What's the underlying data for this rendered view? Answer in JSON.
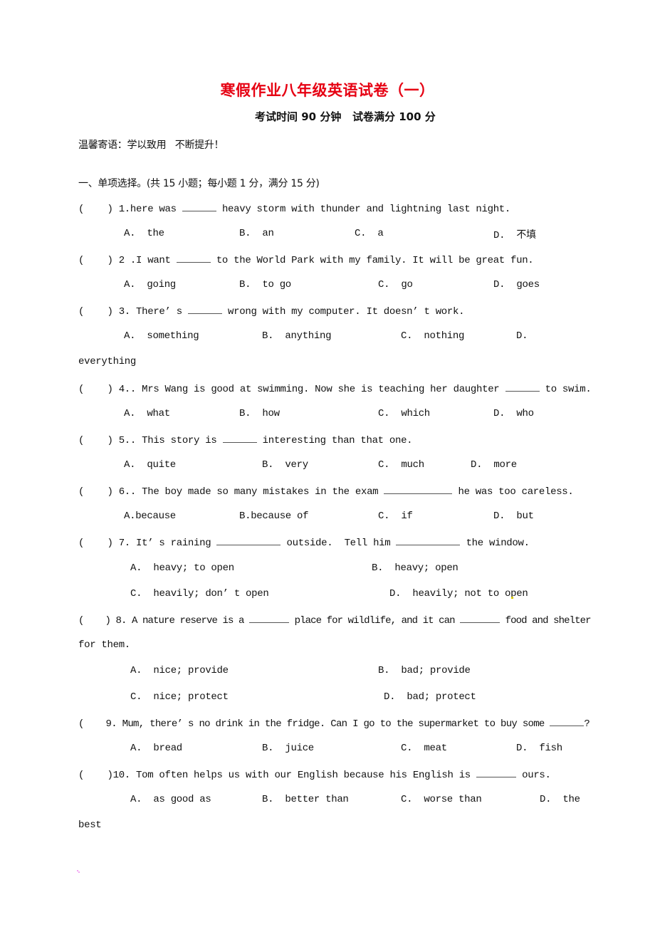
{
  "header": {
    "title": "寒假作业八年级英语试卷（一）",
    "subtitle": "考试时间 90 分钟   试卷满分 100 分",
    "motto": "温馨寄语：学以致用   不断提升！"
  },
  "section": {
    "heading": "一、单项选择。(共 15 小题；每小题 1 分，满分 15 分)"
  },
  "questions": [
    {
      "prefix": "(    ) 1.",
      "text_a": "here was ",
      "text_b": " heavy storm with thunder and lightning last night.",
      "options": [
        "A.  the",
        "B.  an",
        "C.  a",
        "D.  不填"
      ]
    },
    {
      "prefix": "(    ) 2 .",
      "text_a": "I want ",
      "text_b": " to the World Park with my family. It will be great fun.",
      "options": [
        "A.  going",
        "B.  to go",
        "C.  go",
        "D.  goes"
      ]
    },
    {
      "prefix": "(    ) 3.",
      "text_a": " There’ s ",
      "text_b": " wrong with my computer. It doesn’ t work.",
      "options": [
        "A.  something",
        "B.  anything",
        "C.  nothing",
        "D."
      ],
      "wrap": "everything"
    },
    {
      "prefix": "(    ) 4..",
      "text_a": " Mrs Wang is good at swimming. Now she is teaching her daughter ",
      "text_b": " to swim.",
      "options": [
        "A.  what",
        "B.  how",
        "C.  which",
        "D.  who"
      ]
    },
    {
      "prefix": "(    ) 5..",
      "text_a": " This story is ",
      "text_b": " interesting than that one.",
      "options": [
        "A.  quite",
        "B.  very",
        "C.  much",
        "D.  more"
      ]
    },
    {
      "prefix": "(    ) 6..",
      "text_a": " The boy made so many mistakes in the exam ",
      "text_b": " he was too careless.",
      "options": [
        "A.because",
        "B.because of",
        "C.  if",
        "D.  but"
      ]
    },
    {
      "prefix": "(    ) 7.",
      "text_a": " It’ s raining ",
      "text_mid": " outside.  Tell him ",
      "text_b": " the window.",
      "options": [
        "A.  heavy; to open",
        "B.  heavy; open",
        "C.  heavily; don’ t open",
        "D.  heavily; not to open"
      ]
    },
    {
      "prefix": "(    ) 8.",
      "text_a": " A nature reserve is a ",
      "text_mid": " place for wildlife, and it can ",
      "text_b": " food and shelter",
      "wrap": "for them.",
      "options": [
        "A.  nice; provide",
        "B.  bad; provide",
        "C.  nice; protect",
        "D.  bad; protect"
      ]
    },
    {
      "prefix": "(    9.",
      "text_a": " Mum, there’ s no drink in the fridge. Can I go to the supermarket to buy some ",
      "text_b": "?",
      "options": [
        "A.  bread",
        "B.  juice",
        "C.  meat",
        "D.  fish"
      ]
    },
    {
      "prefix": "(    )10.",
      "text_a": " Tom often helps us with our English because his English is ",
      "text_b": " ours.",
      "options": [
        "A.  as good as",
        "B.  better than",
        "C.  worse than",
        "D.  the"
      ],
      "wrap": "best"
    }
  ]
}
